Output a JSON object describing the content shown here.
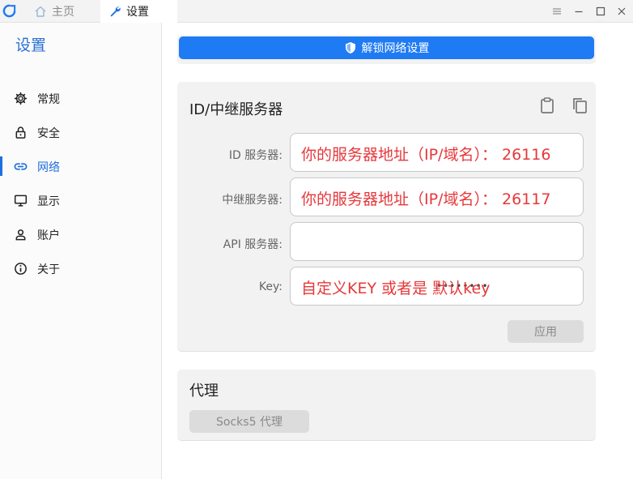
{
  "tabs": {
    "home_label": "主页",
    "settings_label": "设置"
  },
  "sidebar": {
    "title": "设置",
    "items": [
      {
        "label": "常规",
        "icon": "gear-icon"
      },
      {
        "label": "安全",
        "icon": "lock-icon"
      },
      {
        "label": "网络",
        "icon": "link-icon",
        "active": true
      },
      {
        "label": "显示",
        "icon": "monitor-icon"
      },
      {
        "label": "账户",
        "icon": "user-icon"
      },
      {
        "label": "关于",
        "icon": "info-icon"
      }
    ]
  },
  "main": {
    "unlock_button_label": "解锁网络设置",
    "id_panel": {
      "title": "ID/中继服务器",
      "fields": {
        "id_server": {
          "label": "ID 服务器:",
          "value": "你的服务器地址（IP/域名）：  26116"
        },
        "relay_server": {
          "label": "中继服务器:",
          "value": "你的服务器地址（IP/域名）：  26117"
        },
        "api_server": {
          "label": "API 服务器:",
          "value": ""
        },
        "key": {
          "label": "Key:",
          "value": "自定义KEY 或者是 默认key",
          "masked": "••••••••"
        }
      },
      "apply_label": "应用"
    },
    "proxy_panel": {
      "title": "代理",
      "socks_label": "Socks5 代理"
    }
  },
  "colors": {
    "accent": "#1f7bf3",
    "active_nav": "#1f6fdf",
    "annotation_red": "#e6383b"
  }
}
